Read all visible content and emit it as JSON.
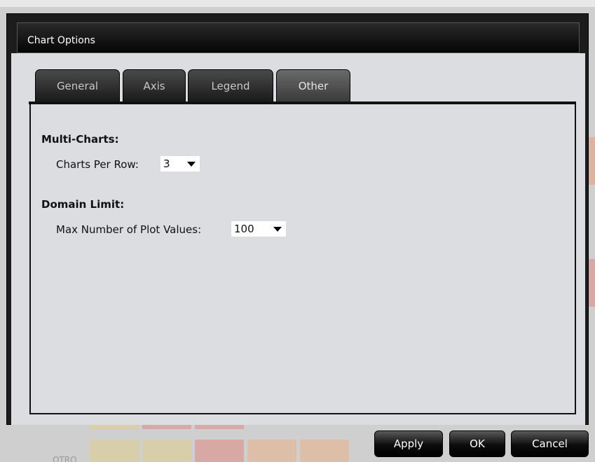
{
  "dialog": {
    "title": "Chart Options"
  },
  "tabs": [
    {
      "label": "General",
      "active": false
    },
    {
      "label": "Axis",
      "active": false
    },
    {
      "label": "Legend",
      "active": false
    },
    {
      "label": "Other",
      "active": true
    }
  ],
  "other_panel": {
    "multi_charts": {
      "heading": "Multi-Charts:",
      "charts_per_row_label": "Charts Per Row:",
      "charts_per_row_value": "3"
    },
    "domain_limit": {
      "heading": "Domain Limit:",
      "max_plot_values_label": "Max Number of Plot Values:",
      "max_plot_values_value": "100"
    }
  },
  "footer": {
    "apply_label": "Apply",
    "ok_label": "OK",
    "cancel_label": "Cancel"
  },
  "background": {
    "partial_label": "OTRO"
  },
  "colors": {
    "dialog_frame": "#1c1c1c",
    "panel_background": "#dcdde0",
    "button_text": "#ffffff"
  }
}
